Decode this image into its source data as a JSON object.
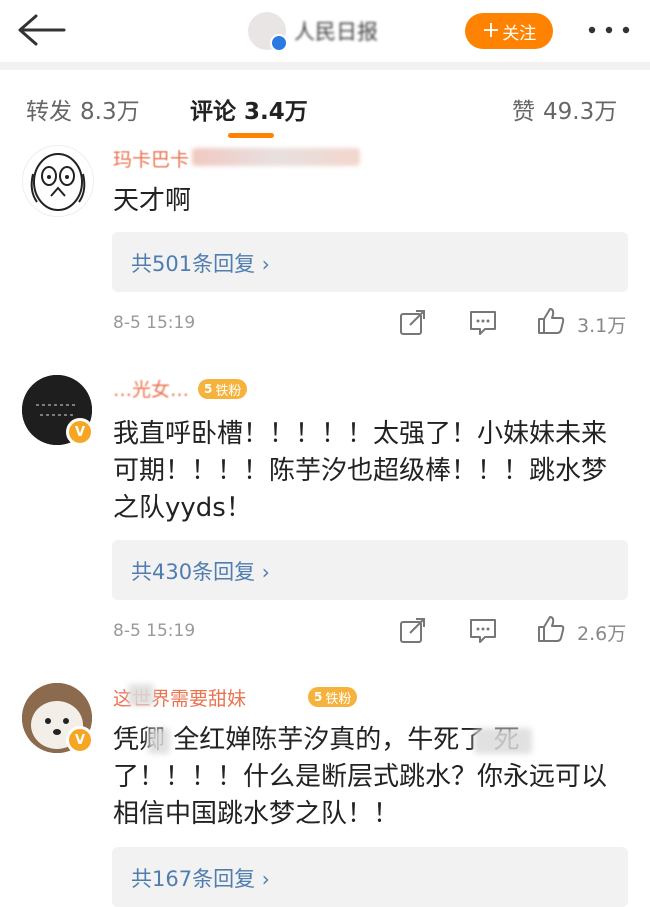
{
  "header": {
    "account_name": "人民日报",
    "follow_label": "关注"
  },
  "tabs": [
    {
      "label": "转发",
      "count": "8.3万"
    },
    {
      "label": "评论",
      "count": "3.4万"
    },
    {
      "label": "赞",
      "count": "49.3万"
    }
  ],
  "comments": [
    {
      "nickname": "玛卡巴卡",
      "text": [
        "天才啊"
      ],
      "reply_label": "共501条回复",
      "time": "8-5 15:19",
      "likes": "3.1万"
    },
    {
      "nickname": "…光女…",
      "fan_level": "5",
      "fan_label": "铁粉",
      "text": [
        "我直呼卧槽！！！！！太强了！小妹妹未来",
        "可期！！！！陈芋汐也超级棒！！！跳水梦",
        "之队yyds！"
      ],
      "reply_label": "共430条回复",
      "time": "8-5 15:19",
      "likes": "2.6万"
    },
    {
      "nickname": "这世界需要甜妹",
      "fan_level": "5",
      "fan_label": "铁粉",
      "text": [
        "凭卿 全红婵陈芋汐真的，牛死了 死",
        "了！！！！什么是断层式跳水？你永远可以",
        "相信中国跳水梦之队！！"
      ],
      "reply_label": "共167条回复"
    }
  ],
  "colors": {
    "accent": "#ff8200",
    "nickname": "#eb7350",
    "reply_link": "#507daf",
    "verified_badge": "#f6a623"
  }
}
